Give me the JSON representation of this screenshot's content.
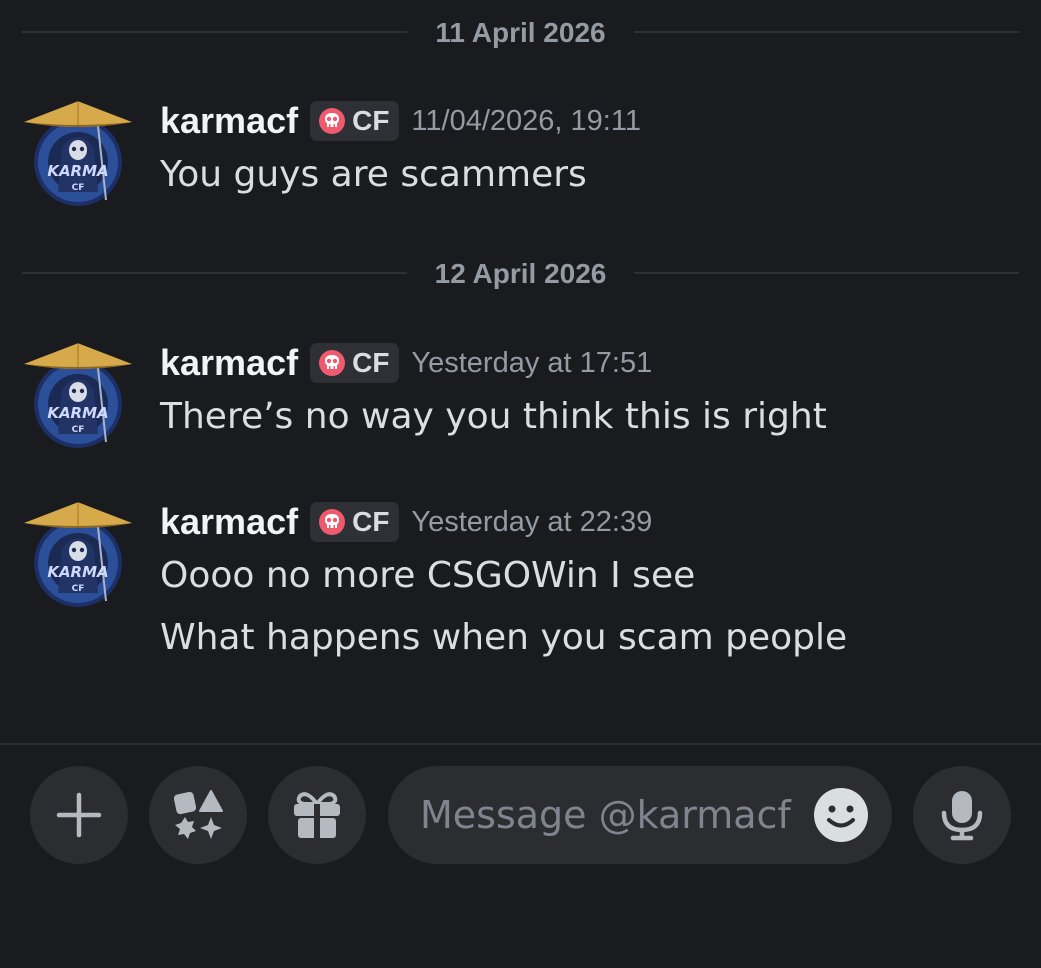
{
  "chat": {
    "date_separators": [
      {
        "label": "11 April 2026"
      },
      {
        "label": "12 April 2026"
      }
    ],
    "messages": [
      {
        "username": "karmacf",
        "tag": "CF",
        "timestamp": "11/04/2026, 19:11",
        "lines": [
          "You guys are scammers"
        ]
      },
      {
        "username": "karmacf",
        "tag": "CF",
        "timestamp": "Yesterday at 17:51",
        "lines": [
          "There’s no way you think this is right"
        ]
      },
      {
        "username": "karmacf",
        "tag": "CF",
        "timestamp": "Yesterday at 22:39",
        "lines": [
          "Oooo no more CSGOWin I see",
          "What happens when you scam people"
        ]
      }
    ]
  },
  "composer": {
    "placeholder": "Message @karmacf",
    "value": "",
    "icons": {
      "add": "plus-icon",
      "apps": "apps-icon",
      "gift": "gift-icon",
      "emoji": "emoji-icon",
      "voice": "microphone-icon"
    }
  },
  "colors": {
    "background": "#1a1b1e",
    "button_bg": "#2b2d31",
    "tag_bg": "#2e3035",
    "text": "#dbdee1",
    "muted": "#949ba4",
    "avatar_hat": "#d6a94a",
    "avatar_circle": "#2c4f9a",
    "skull": "#f05a6e"
  }
}
